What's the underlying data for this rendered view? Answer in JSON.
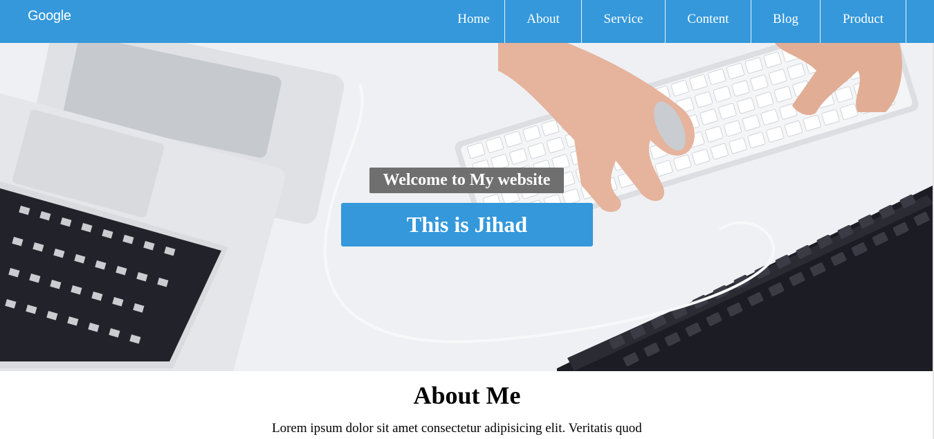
{
  "brand": {
    "logo": "Google"
  },
  "nav": {
    "items": [
      {
        "label": "Home"
      },
      {
        "label": "About"
      },
      {
        "label": "Service"
      },
      {
        "label": "Content"
      },
      {
        "label": "Blog"
      },
      {
        "label": "Product"
      }
    ]
  },
  "hero": {
    "subtitle": "Welcome to My website",
    "title": "This is Jihad"
  },
  "about": {
    "title": "About Me",
    "text": "Lorem ipsum dolor sit amet consectetur adipisicing elit. Veritatis quod"
  },
  "colors": {
    "accent": "#3498db",
    "subtitle_bg": "#6f6f6f",
    "nav_text": "#ffffff"
  }
}
